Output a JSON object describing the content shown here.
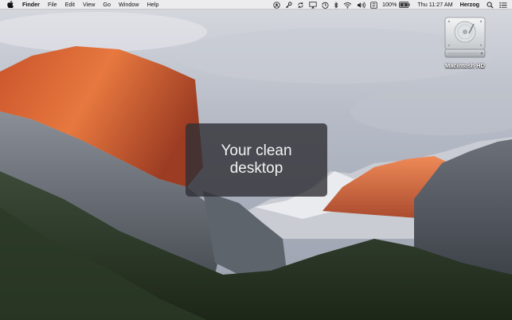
{
  "menubar": {
    "apple_icon": "apple-logo-icon",
    "app_name": "Finder",
    "menus": [
      "File",
      "Edit",
      "View",
      "Go",
      "Window",
      "Help"
    ],
    "status_icons": [
      "user-icon",
      "key-icon",
      "sync-icon",
      "airplay-icon",
      "time-machine-icon",
      "bluetooth-icon",
      "wifi-icon",
      "volume-icon",
      "input-source-icon"
    ],
    "battery_percent": "100%",
    "battery_icon": "battery-charging-icon",
    "clock": "Thu 11:27 AM",
    "user_name": "Herzog",
    "search_icon": "spotlight-search-icon",
    "notification_icon": "notification-center-icon"
  },
  "hud": {
    "line1": "Your clean",
    "line2": "desktop"
  },
  "desktop_icons": [
    {
      "label": "Macintosh HD",
      "icon": "hard-drive-icon"
    }
  ],
  "colors": {
    "menubar_bg": "#eeeef0",
    "hud_bg": "#303034",
    "rock_glow": "#e0642e"
  }
}
